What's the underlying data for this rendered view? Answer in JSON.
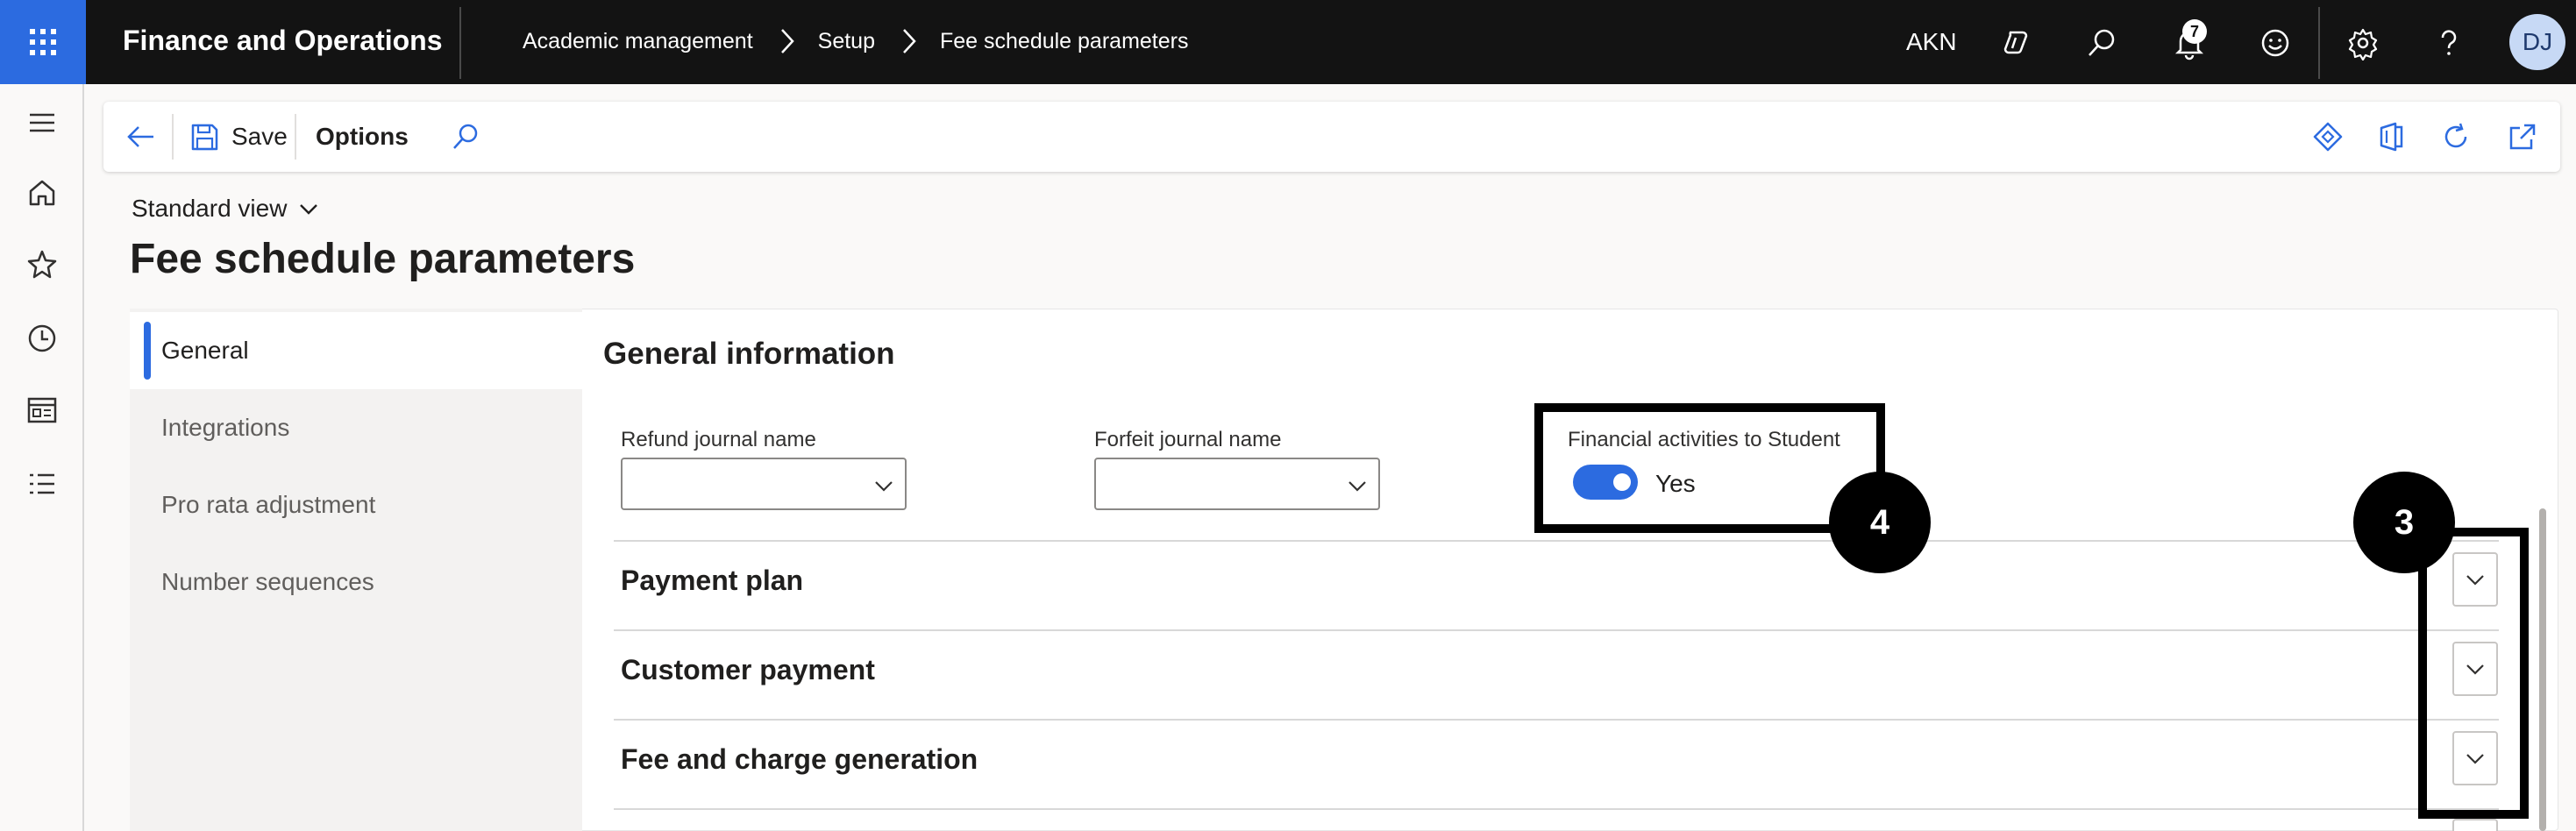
{
  "topbar": {
    "app_title": "Finance and Operations",
    "breadcrumb": [
      "Academic management",
      "Setup",
      "Fee schedule parameters"
    ],
    "company": "AKN",
    "notification_count": "7",
    "user_initials": "DJ"
  },
  "actionpane": {
    "save_label": "Save",
    "options_label": "Options"
  },
  "page": {
    "view_selector": "Standard view",
    "title": "Fee schedule parameters"
  },
  "tabs": [
    {
      "label": "General",
      "active": true
    },
    {
      "label": "Integrations",
      "active": false
    },
    {
      "label": "Pro rata adjustment",
      "active": false
    },
    {
      "label": "Number sequences",
      "active": false
    }
  ],
  "general": {
    "section_title": "General information",
    "refund_journal_label": "Refund journal name",
    "refund_journal_value": "",
    "forfeit_journal_label": "Forfeit journal name",
    "forfeit_journal_value": "",
    "financial_activities_label": "Financial activities to Student",
    "financial_activities_value": "Yes"
  },
  "fasttabs": [
    {
      "label": "Payment plan"
    },
    {
      "label": "Customer payment"
    },
    {
      "label": "Fee and charge generation"
    }
  ],
  "callouts": [
    "4",
    "3"
  ],
  "colors": {
    "topbar_bg": "#131313",
    "accent": "#2c6be0"
  }
}
